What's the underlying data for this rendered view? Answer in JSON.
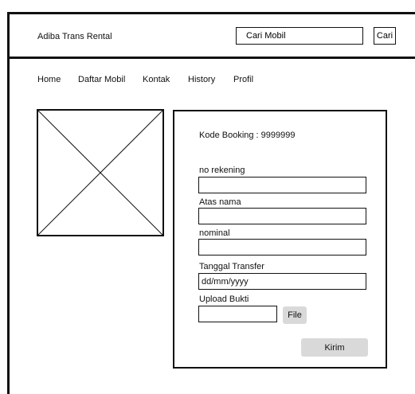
{
  "header": {
    "brand": "Adiba Trans Rental",
    "search_value": "Cari Mobil",
    "search_button": "Cari"
  },
  "nav": {
    "items": [
      "Home",
      "Daftar Mobil",
      "Kontak",
      "History",
      "Profil"
    ]
  },
  "form": {
    "booking_code": "Kode Booking : 9999999",
    "account_number_label": "no rekening",
    "account_name_label": "Atas nama",
    "amount_label": "nominal",
    "transfer_date_label": "Tanggal Transfer",
    "transfer_date_placeholder": "dd/mm/yyyy",
    "upload_label": "Upload Bukti",
    "file_button": "File",
    "submit_button": "Kirim"
  },
  "colors": {
    "line": "#111111",
    "button_gray": "#d9d9d9"
  }
}
